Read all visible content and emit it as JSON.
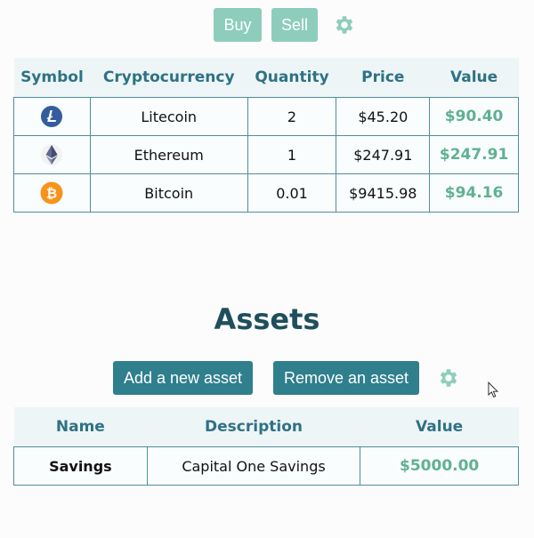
{
  "crypto_toolbar": {
    "buy_label": "Buy",
    "sell_label": "Sell"
  },
  "crypto_table": {
    "headers": {
      "symbol": "Symbol",
      "name": "Cryptocurrency",
      "quantity": "Quantity",
      "price": "Price",
      "value": "Value"
    },
    "rows": [
      {
        "icon": "litecoin-icon",
        "name": "Litecoin",
        "quantity": "2",
        "price": "$45.20",
        "value": "$90.40"
      },
      {
        "icon": "ethereum-icon",
        "name": "Ethereum",
        "quantity": "1",
        "price": "$247.91",
        "value": "$247.91"
      },
      {
        "icon": "bitcoin-icon",
        "name": "Bitcoin",
        "quantity": "0.01",
        "price": "$9415.98",
        "value": "$94.16"
      }
    ]
  },
  "assets_section": {
    "title": "Assets",
    "add_label": "Add a new asset",
    "remove_label": "Remove an asset"
  },
  "assets_table": {
    "headers": {
      "name": "Name",
      "description": "Description",
      "value": "Value"
    },
    "rows": [
      {
        "name": "Savings",
        "description": "Capital One Savings",
        "value": "$5000.00"
      }
    ]
  },
  "colors": {
    "accent_light": "#8ecdbb",
    "accent_dark": "#2f7f8d",
    "header_text": "#2e7285",
    "value_text": "#5fb191",
    "title_text": "#1f4f5d"
  },
  "icons": [
    "gear-icon",
    "litecoin-icon",
    "ethereum-icon",
    "bitcoin-icon",
    "mouse-cursor-icon"
  ]
}
